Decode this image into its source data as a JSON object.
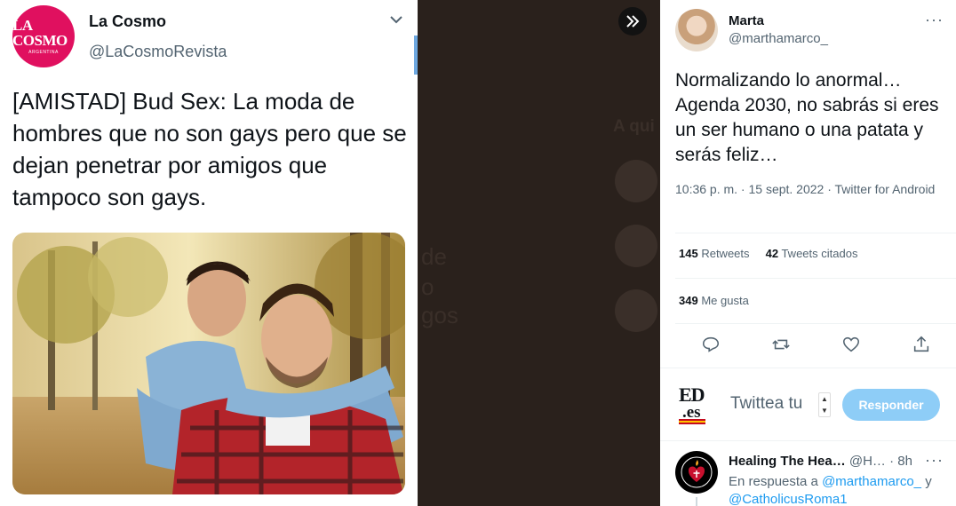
{
  "left_tweet": {
    "avatar": {
      "logo_main": "LA COSMO",
      "logo_sub": "ARGENTINA",
      "color": "#e0105f"
    },
    "name": "La Cosmo",
    "handle": "@LaCosmoRevista",
    "text": "[AMISTAD] Bud Sex: La moda de hombres que no son gays pero que se dejan penetrar por amigos que tampoco son gays.",
    "icons": {
      "menu": "chevron-down-icon"
    }
  },
  "middle_overlay": {
    "bg_color": "#2a211c",
    "faint_texts": [
      "A qui",
      "de",
      "o",
      "gos"
    ],
    "expand_icon": "double-chevron-right-icon"
  },
  "right_tweet": {
    "name": "Marta",
    "handle": "@marthamarco_",
    "more": "···",
    "text": "Normalizando lo anormal…  Agenda 2030, no sabrás si eres un ser humano o una patata y serás feliz…",
    "meta": "10:36 p. m. · 15 sept. 2022 · Twitter for Android",
    "stats": {
      "retweets_count": "145",
      "retweets_label": "Retweets",
      "quotes_count": "42",
      "quotes_label": "Tweets citados",
      "likes_count": "349",
      "likes_label": "Me gusta"
    },
    "actions": [
      "reply-icon",
      "retweet-icon",
      "like-icon",
      "share-icon"
    ],
    "reply_box": {
      "logo_top": "ED",
      "logo_bottom": ".es",
      "placeholder": "Twittea tu",
      "stepper_up": "▲",
      "stepper_down": "▼",
      "button": "Responder",
      "button_color": "#8ecdf7"
    },
    "reply": {
      "name": "Healing The Hea…",
      "handle": "@H…",
      "time": "· 8h",
      "more": "···",
      "in_reply_prefix": "En respuesta a",
      "mention1": "@marthamarco_",
      "conj": "y",
      "mention2": "@CatholicusRoma1"
    }
  }
}
